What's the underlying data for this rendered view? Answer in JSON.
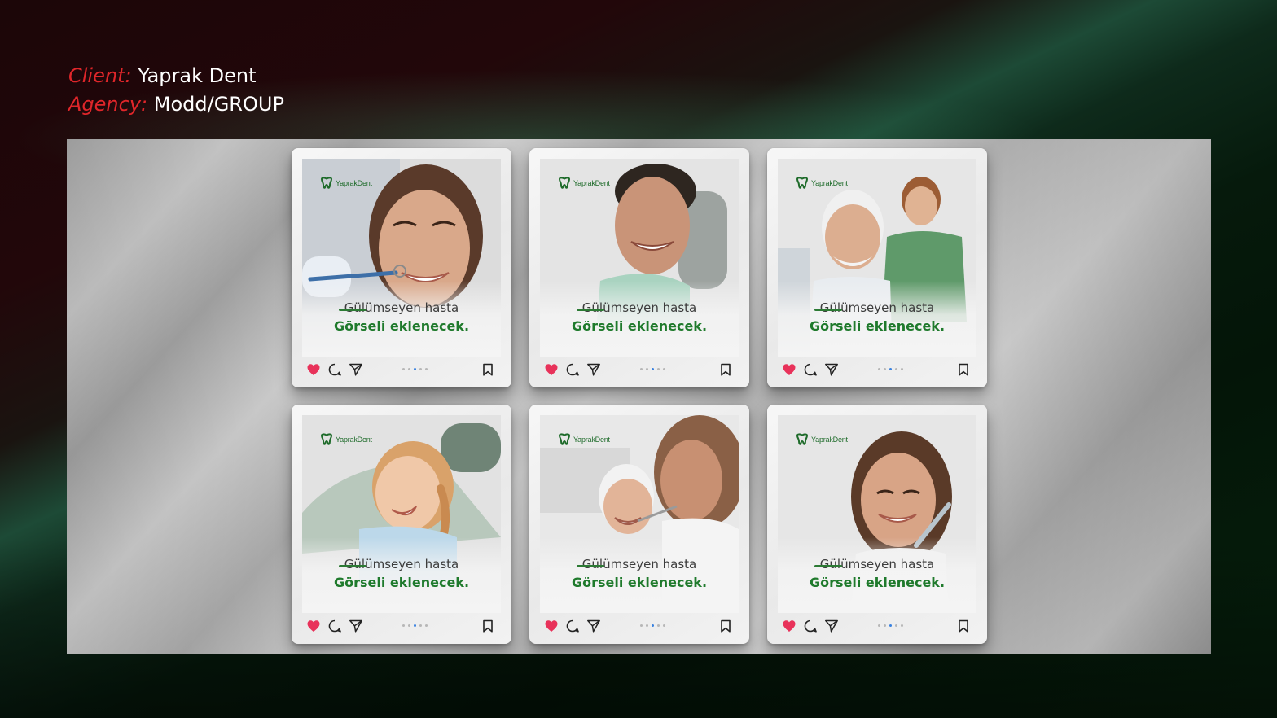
{
  "credits": {
    "client_key": "Client:",
    "client_value": "Yaprak Dent",
    "agency_key": "Agency:",
    "agency_value": "Modd/GROUP"
  },
  "brand": {
    "logo_text": "YaprakDent",
    "accent_green": "#1f7a2c",
    "label_red": "#e0262a"
  },
  "posts": [
    {
      "caption_line1": "Gülümseyen hasta",
      "caption_line2": "Görseli eklenecek.",
      "active_dot": 3
    },
    {
      "caption_line1": "Gülümseyen hasta",
      "caption_line2": "Görseli eklenecek.",
      "active_dot": 3
    },
    {
      "caption_line1": "Gülümseyen hasta",
      "caption_line2": "Görseli eklenecek.",
      "active_dot": 3
    },
    {
      "caption_line1": "Gülümseyen hasta",
      "caption_line2": "Görseli eklenecek.",
      "active_dot": 3
    },
    {
      "caption_line1": "Gülümseyen hasta",
      "caption_line2": "Görseli eklenecek.",
      "active_dot": 3
    },
    {
      "caption_line1": "Gülümseyen hasta",
      "caption_line2": "Görseli eklenecek.",
      "active_dot": 3
    }
  ],
  "icons": {
    "like": "heart-icon",
    "comment": "comment-icon",
    "share": "send-icon",
    "save": "bookmark-icon"
  }
}
